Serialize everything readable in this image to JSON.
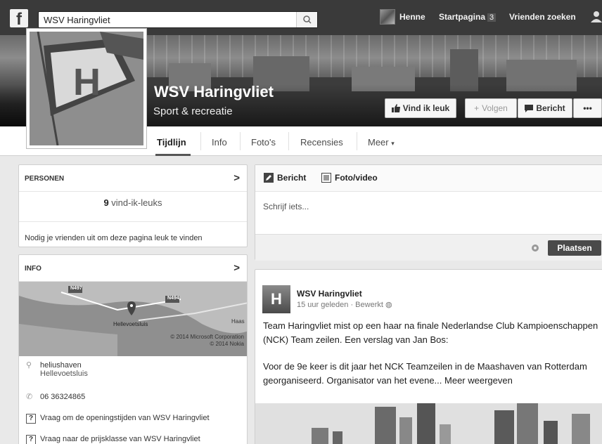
{
  "topbar": {
    "logo": "f",
    "search_value": "WSV Haringvliet",
    "nav_user": "Henne",
    "nav_home": "Startpagina",
    "nav_home_count": "3",
    "nav_find_friends": "Vrienden zoeken"
  },
  "page": {
    "title": "WSV Haringvliet",
    "category": "Sport & recreatie"
  },
  "actions": {
    "like": "Vind ik leuk",
    "follow": "Volgen",
    "message": "Bericht",
    "more": "•••"
  },
  "tabs": [
    "Tijdlijn",
    "Info",
    "Foto's",
    "Recensies",
    "Meer"
  ],
  "people": {
    "header": "PERSONEN",
    "likes_count": "9",
    "likes_label": "vind-ik-leuks",
    "invite": "Nodig je vrienden uit om deze pagina leuk te vinden"
  },
  "info": {
    "header": "INFO",
    "map_labels": {
      "road1": "N497",
      "road2": "N494",
      "city": "Hellevoetsluis",
      "town": "Haas",
      "credit1": "© 2014 Microsoft Corporation",
      "credit2": "© 2014 Nokia"
    },
    "address_line1": "heliushaven",
    "address_line2": "Hellevoetsluis",
    "phone": "06 36324865",
    "ask_hours": "Vraag om de openingstijden van WSV Haringvliet",
    "ask_price": "Vraag naar de prijsklasse van WSV Haringvliet"
  },
  "composer": {
    "tab_post": "Bericht",
    "tab_photo": "Foto/video",
    "placeholder": "Schrijf iets...",
    "submit": "Plaatsen"
  },
  "post": {
    "avatar_letter": "H",
    "author": "WSV Haringvliet",
    "meta": "15 uur geleden · Bewerkt",
    "paragraph1": "Team Haringvliet mist op een haar na finale Nederlandse Club Kampioenschappen (NCK) Team zeilen. Een verslag van Jan Bos:",
    "paragraph2": "Voor de 9e keer is dit jaar het NCK Teamzeilen in de Maashaven van Rotterdam georganiseerd. Organisator van het evene...",
    "see_more": "Meer weergeven"
  }
}
